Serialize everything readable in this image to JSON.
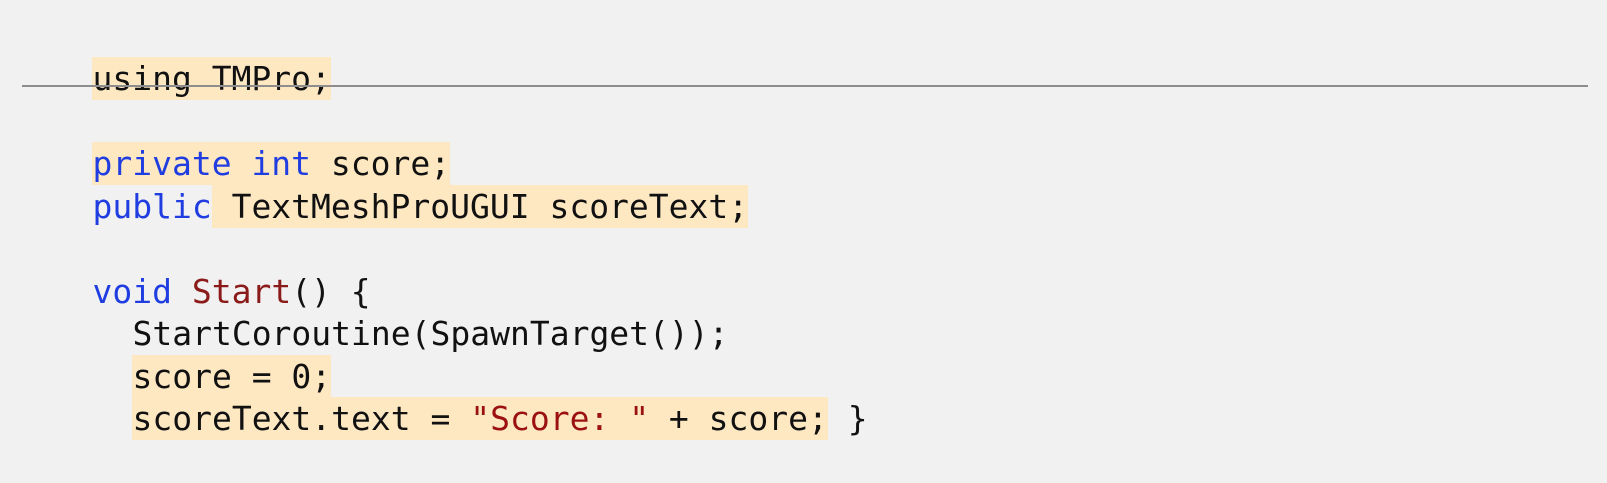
{
  "snippet_top": {
    "using_line": "using TMPro;"
  },
  "snippet_bottom": {
    "line_private": {
      "keyword_private": "private",
      "space_1": " ",
      "keyword_int": "int",
      "rest": " score;"
    },
    "line_public": {
      "keyword_public": "public",
      "rest": " TextMeshProUGUI scoreText;"
    },
    "line_void": {
      "keyword_void": "void",
      "space": " ",
      "method_start": "Start",
      "rest": "() {"
    },
    "line_coroutine": {
      "text": "StartCoroutine(SpawnTarget());"
    },
    "line_score_init": {
      "text": "score = 0;"
    },
    "line_score_text": {
      "prefix": "scoreText.text = ",
      "string_literal": "\"Score: \"",
      "suffix": " + score;",
      "close_brace": " }"
    }
  },
  "colors": {
    "background": "#f1f1f1",
    "highlight": "#fde8c2",
    "keyword": "#1f3de0",
    "method": "#8b1a1a",
    "string": "#9b1111",
    "text": "#111111",
    "divider": "#8d8d8d"
  }
}
